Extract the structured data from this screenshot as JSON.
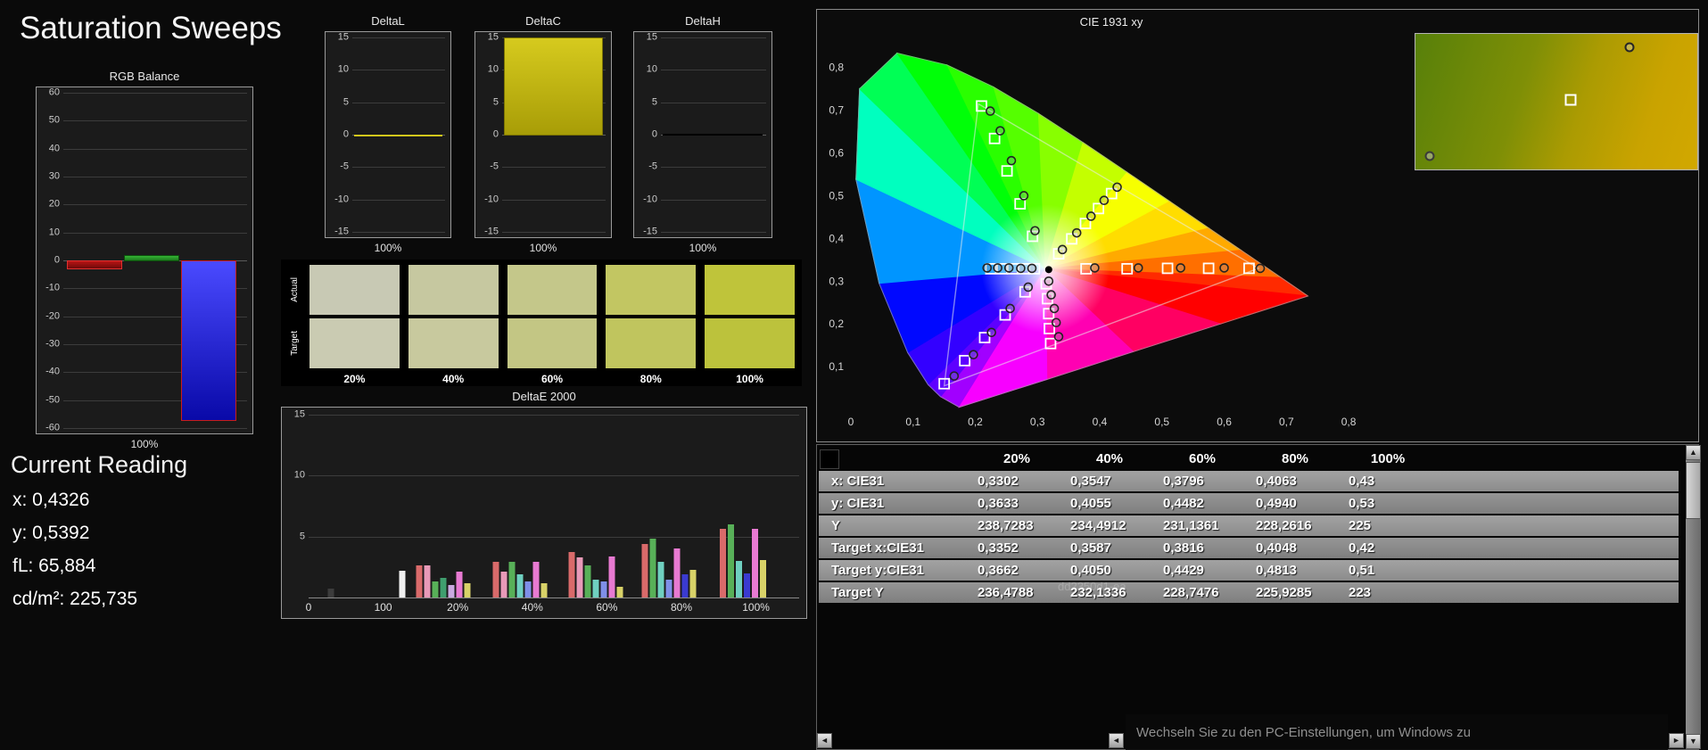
{
  "page": {
    "title": "Saturation Sweeps"
  },
  "current_reading": {
    "heading": "Current Reading",
    "lines": [
      "x: 0,4326",
      "y: 0,5392",
      "fL: 65,884",
      "cd/m²: 225,735"
    ]
  },
  "toast": {
    "text": "Wechseln Sie zu den PC-Einstellungen, um Windows zu"
  },
  "watermark": {
    "text": "dd2350d1-ea"
  },
  "scrollbar": {
    "left": "◄",
    "right": "►",
    "up": "▲",
    "down": "▼"
  },
  "chart_data": [
    {
      "id": "rgb_balance",
      "type": "bar",
      "title": "RGB Balance",
      "xlabel": "100%",
      "ylim": [
        -60,
        60
      ],
      "ytick_step": 10,
      "categories": [
        "Red",
        "Green",
        "Blue"
      ],
      "values": [
        -3,
        2,
        -57
      ],
      "bars": [
        {
          "name": "red",
          "fill_top": "#b81414",
          "fill_bottom": "#6e0a0a",
          "border": "#e03030"
        },
        {
          "name": "green",
          "fill_top": "#35b335",
          "fill_bottom": "#1d7a1d",
          "border": "#0c4f0c"
        },
        {
          "name": "blue",
          "fill_top": "#4a4aff",
          "fill_bottom": "#0909a8",
          "border": "#c81d1d"
        }
      ]
    },
    {
      "id": "delta_l",
      "type": "bar",
      "title": "DeltaL",
      "xlabel": "100%",
      "ylim": [
        -15,
        15
      ],
      "ytick_step": 5,
      "categories": [
        "100%"
      ],
      "values": [
        -0.2
      ],
      "bar": {
        "fill_top": "#d2c71c",
        "fill_bottom": "#b0a60e",
        "border": "#8a8200"
      }
    },
    {
      "id": "delta_c",
      "type": "bar",
      "title": "DeltaC",
      "xlabel": "100%",
      "ylim": [
        -15,
        15
      ],
      "ytick_step": 5,
      "categories": [
        "100%"
      ],
      "values": [
        15
      ],
      "bar": {
        "fill_top": "#d6ca1e",
        "fill_bottom": "#a89d07",
        "border": "#7a7203"
      }
    },
    {
      "id": "delta_h",
      "type": "bar",
      "title": "DeltaH",
      "xlabel": "100%",
      "ylim": [
        -15,
        15
      ],
      "ytick_step": 5,
      "categories": [
        "100%"
      ],
      "values": [
        0.12
      ],
      "bar": {
        "fill_top": "#000000",
        "fill_bottom": "#000000",
        "border": "#000000"
      }
    },
    {
      "id": "saturation_swatches",
      "type": "table",
      "row_labels": [
        "Actual",
        "Target"
      ],
      "categories": [
        "20%",
        "40%",
        "60%",
        "80%",
        "100%"
      ],
      "actual_colors": [
        "#c8c9b4",
        "#c6c8a0",
        "#c4c78a",
        "#c2c662",
        "#bfc43a"
      ],
      "target_colors": [
        "#cacbb2",
        "#c8c99e",
        "#c3c684",
        "#c0c55e",
        "#bcc23c"
      ]
    },
    {
      "id": "deltae_2000",
      "type": "bar",
      "title": "DeltaE 2000",
      "ylim": [
        0,
        15
      ],
      "yticks": [
        5,
        10,
        15
      ],
      "x_ticks": [
        "0",
        "100",
        "20%",
        "40%",
        "60%",
        "80%",
        "100%"
      ],
      "groups": [
        {
          "at": 0.045,
          "bars": [
            {
              "c": "#3c3c3c",
              "h": 0.7
            }
          ]
        },
        {
          "at": 0.19,
          "bars": [
            {
              "c": "#f0f0f0",
              "h": 2.2
            }
          ]
        },
        {
          "at": 0.275,
          "bars": [
            {
              "c": "#d96a6a",
              "h": 2.6
            },
            {
              "c": "#e89ab8",
              "h": 2.6
            },
            {
              "c": "#58b058",
              "h": 1.3
            },
            {
              "c": "#3f9e6e",
              "h": 1.6
            },
            {
              "c": "#caa9e0",
              "h": 1.0
            },
            {
              "c": "#e87ad2",
              "h": 2.1
            },
            {
              "c": "#d8d268",
              "h": 1.2
            }
          ]
        },
        {
          "at": 0.43,
          "bars": [
            {
              "c": "#d96a6a",
              "h": 2.9
            },
            {
              "c": "#e89ab8",
              "h": 2.1
            },
            {
              "c": "#58b058",
              "h": 2.9
            },
            {
              "c": "#6fd0c0",
              "h": 1.9
            },
            {
              "c": "#7f8fe8",
              "h": 1.3
            },
            {
              "c": "#e87ad2",
              "h": 2.9
            },
            {
              "c": "#d8d268",
              "h": 1.2
            }
          ]
        },
        {
          "at": 0.585,
          "bars": [
            {
              "c": "#d96a6a",
              "h": 3.7
            },
            {
              "c": "#e89ab8",
              "h": 3.3
            },
            {
              "c": "#58b058",
              "h": 2.6
            },
            {
              "c": "#6fd0c0",
              "h": 1.5
            },
            {
              "c": "#7f8fe8",
              "h": 1.3
            },
            {
              "c": "#e87ad2",
              "h": 3.4
            },
            {
              "c": "#d8d268",
              "h": 0.9
            }
          ]
        },
        {
          "at": 0.735,
          "bars": [
            {
              "c": "#d96a6a",
              "h": 4.4
            },
            {
              "c": "#58b058",
              "h": 4.8
            },
            {
              "c": "#6fd0c0",
              "h": 2.9
            },
            {
              "c": "#7f8fe8",
              "h": 1.5
            },
            {
              "c": "#e87ad2",
              "h": 4.0
            },
            {
              "c": "#3a3ad0",
              "h": 1.9
            },
            {
              "c": "#d8d268",
              "h": 2.3
            }
          ]
        },
        {
          "at": 0.885,
          "bars": [
            {
              "c": "#d96a6a",
              "h": 5.6
            },
            {
              "c": "#58b058",
              "h": 6.0
            },
            {
              "c": "#6fd0c0",
              "h": 3.0
            },
            {
              "c": "#3a3ad0",
              "h": 2.0
            },
            {
              "c": "#e87ad2",
              "h": 5.6
            },
            {
              "c": "#d8d268",
              "h": 3.1
            }
          ]
        }
      ]
    },
    {
      "id": "cie_1931",
      "type": "scatter",
      "title": "CIE 1931 xy",
      "x_ticks": [
        "0",
        "0,1",
        "0,2",
        "0,3",
        "0,4",
        "0,5",
        "0,6",
        "0,7",
        "0,8"
      ],
      "y_ticks": [
        "0,1",
        "0,2",
        "0,3",
        "0,4",
        "0,5",
        "0,6",
        "0,7",
        "0,8"
      ],
      "xlim": [
        0,
        0.82
      ],
      "ylim": [
        0,
        0.86
      ],
      "white_point": [
        0.3127,
        0.329
      ],
      "measured_white": [
        0.318,
        0.327
      ],
      "gamut_triangle": [
        [
          0.205,
          0.715
        ],
        [
          0.655,
          0.33
        ],
        [
          0.15,
          0.055
        ]
      ],
      "targets": [
        [
          0.378,
          0.329
        ],
        [
          0.444,
          0.329
        ],
        [
          0.509,
          0.33
        ],
        [
          0.575,
          0.33
        ],
        [
          0.64,
          0.33
        ],
        [
          0.292,
          0.405
        ],
        [
          0.272,
          0.481
        ],
        [
          0.251,
          0.558
        ],
        [
          0.231,
          0.634
        ],
        [
          0.21,
          0.71
        ],
        [
          0.28,
          0.275
        ],
        [
          0.248,
          0.221
        ],
        [
          0.215,
          0.168
        ],
        [
          0.183,
          0.114
        ],
        [
          0.15,
          0.06
        ],
        [
          0.295,
          0.329
        ],
        [
          0.278,
          0.329
        ],
        [
          0.26,
          0.329
        ],
        [
          0.243,
          0.329
        ],
        [
          0.225,
          0.329
        ],
        [
          0.314,
          0.294
        ],
        [
          0.316,
          0.259
        ],
        [
          0.318,
          0.224
        ],
        [
          0.319,
          0.189
        ],
        [
          0.321,
          0.154
        ],
        [
          0.334,
          0.364
        ],
        [
          0.355,
          0.399
        ],
        [
          0.377,
          0.435
        ],
        [
          0.398,
          0.47
        ],
        [
          0.419,
          0.505
        ]
      ],
      "measured": [
        [
          0.392,
          0.331
        ],
        [
          0.462,
          0.331
        ],
        [
          0.53,
          0.331
        ],
        [
          0.6,
          0.331
        ],
        [
          0.658,
          0.33
        ],
        [
          0.296,
          0.418
        ],
        [
          0.278,
          0.5
        ],
        [
          0.258,
          0.582
        ],
        [
          0.24,
          0.652
        ],
        [
          0.224,
          0.698
        ],
        [
          0.285,
          0.286
        ],
        [
          0.256,
          0.236
        ],
        [
          0.226,
          0.18
        ],
        [
          0.197,
          0.128
        ],
        [
          0.166,
          0.078
        ],
        [
          0.291,
          0.33
        ],
        [
          0.273,
          0.33
        ],
        [
          0.254,
          0.331
        ],
        [
          0.236,
          0.331
        ],
        [
          0.219,
          0.331
        ],
        [
          0.318,
          0.3
        ],
        [
          0.322,
          0.268
        ],
        [
          0.327,
          0.236
        ],
        [
          0.33,
          0.203
        ],
        [
          0.334,
          0.17
        ],
        [
          0.34,
          0.374
        ],
        [
          0.363,
          0.413
        ],
        [
          0.386,
          0.452
        ],
        [
          0.407,
          0.489
        ],
        [
          0.428,
          0.52
        ]
      ]
    },
    {
      "id": "results_table",
      "type": "table",
      "headers": [
        "",
        "20%",
        "40%",
        "60%",
        "80%",
        "100%"
      ],
      "rows": [
        {
          "label": "x: CIE31",
          "values": [
            "0,3302",
            "0,3547",
            "0,3796",
            "0,4063",
            "0,43"
          ]
        },
        {
          "label": "y: CIE31",
          "values": [
            "0,3633",
            "0,4055",
            "0,4482",
            "0,4940",
            "0,53"
          ]
        },
        {
          "label": "Y",
          "values": [
            "238,7283",
            "234,4912",
            "231,1361",
            "228,2616",
            "225"
          ]
        },
        {
          "label": "Target x:CIE31",
          "values": [
            "0,3352",
            "0,3587",
            "0,3816",
            "0,4048",
            "0,42"
          ]
        },
        {
          "label": "Target y:CIE31",
          "values": [
            "0,3662",
            "0,4050",
            "0,4429",
            "0,4813",
            "0,51"
          ]
        },
        {
          "label": "Target Y",
          "values": [
            "236,4788",
            "232,1336",
            "228,7476",
            "225,9285",
            "223"
          ]
        }
      ]
    }
  ]
}
